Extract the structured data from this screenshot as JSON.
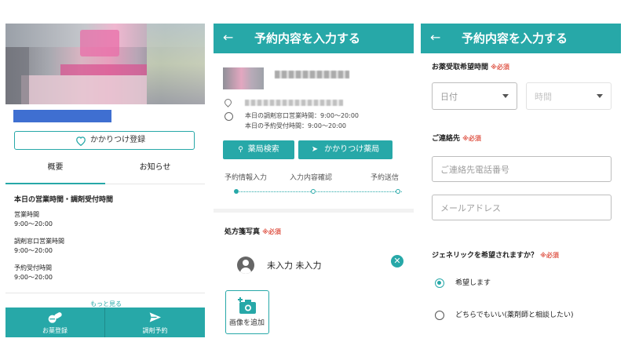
{
  "screen1": {
    "favorite_button_label": "かかりつけ登録",
    "tabs": [
      {
        "label": "概要"
      },
      {
        "label": "お知らせ"
      }
    ],
    "hours_heading": "本日の営業時間・調剤受付時間",
    "hours": [
      {
        "label": "営業時間",
        "value": "9:00〜20:00"
      },
      {
        "label": "調剤窓口営業時間",
        "value": "9:00〜20:00"
      },
      {
        "label": "予約受付時間",
        "value": "9:00〜20:00"
      }
    ],
    "more_link": "もっと見る",
    "bottom_nav": [
      {
        "label": "お薬登録"
      },
      {
        "label": "調剤予約"
      }
    ]
  },
  "screen2": {
    "title": "予約内容を入力する",
    "info_line_1": "本日の調剤窓口営業時間：9:00〜20:00",
    "info_line_2": "本日の予約受付時間：9:00〜20:00",
    "search_button": "薬局検索",
    "favorite_button": "かかりつけ薬局",
    "steps": [
      {
        "label": "予約情報入力"
      },
      {
        "label": "入力内容確認"
      },
      {
        "label": "予約送信"
      }
    ],
    "prescription_label": "処方箋写真",
    "required_label": "※必須",
    "patient_name": "未入力 未入力",
    "add_image_label": "画像を追加"
  },
  "screen3": {
    "title": "予約内容を入力する",
    "pickup_label": "お薬受取希望時間",
    "required_label": "※必須",
    "date_placeholder": "日付",
    "time_placeholder": "時間",
    "contact_label": "ご連絡先",
    "phone_placeholder": "ご連絡先電話番号",
    "email_placeholder": "メールアドレス",
    "generic_question": "ジェネリックを希望されますか？",
    "generic_options": [
      {
        "label": "希望します",
        "selected": true
      },
      {
        "label": "どちらでもいい(薬剤師と相談したい)",
        "selected": false
      }
    ]
  },
  "colors": {
    "accent": "#27a8a8",
    "required": "#e05a4c",
    "name_bar": "#3f6fd1"
  }
}
